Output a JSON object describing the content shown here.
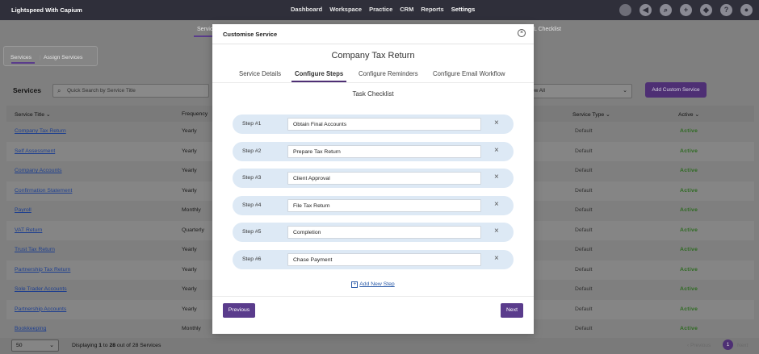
{
  "app": {
    "brand": "Lightspeed With Capium"
  },
  "nav": {
    "items": [
      "Dashboard",
      "Workspace",
      "Practice",
      "CRM",
      "Reports",
      "Settings"
    ],
    "active": "Settings"
  },
  "top_icons": [
    "circle-icon",
    "megaphone-icon",
    "search-icon",
    "plus-icon",
    "tag-icon",
    "help-icon",
    "user-icon"
  ],
  "subtabs": {
    "services": "Servic",
    "checklist": "L Checklist"
  },
  "segment": {
    "services": "Services",
    "assign": "Assign Services"
  },
  "list": {
    "title": "Services",
    "search_placeholder": "Quick Search by Service Title",
    "filter_value": "ow All",
    "add_button": "Add Custom Service",
    "columns": {
      "title": "Service Title",
      "frequency": "Frequency",
      "type": "Service Type",
      "active": "Active"
    },
    "rows": [
      {
        "title": "Company Tax Return",
        "frequency": "Yearly",
        "type": "Default",
        "active": "Active"
      },
      {
        "title": "Self Assessment",
        "frequency": "Yearly",
        "type": "Default",
        "active": "Active"
      },
      {
        "title": "Company Accounts",
        "frequency": "Yearly",
        "type": "Default",
        "active": "Active"
      },
      {
        "title": "Confirmation Statement",
        "frequency": "Yearly",
        "type": "Default",
        "active": "Active"
      },
      {
        "title": "Payroll",
        "frequency": "Monthly",
        "type": "Default",
        "active": "Active"
      },
      {
        "title": "VAT Return",
        "frequency": "Quarterly",
        "type": "Default",
        "active": "Active"
      },
      {
        "title": "Trust Tax Return",
        "frequency": "Yearly",
        "type": "Default",
        "active": "Active"
      },
      {
        "title": "Partnership Tax Return",
        "frequency": "Yearly",
        "type": "Default",
        "active": "Active"
      },
      {
        "title": "Sole Trader Accounts",
        "frequency": "Yearly",
        "type": "Default",
        "active": "Active"
      },
      {
        "title": "Partnership Accounts",
        "frequency": "Yearly",
        "type": "Default",
        "active": "Active"
      },
      {
        "title": "Bookkeeping",
        "frequency": "Monthly",
        "type": "Default",
        "active": "Active"
      }
    ]
  },
  "footer": {
    "page_size": "50",
    "displaying_prefix": "Displaying ",
    "range_start": "1",
    "to": " to ",
    "range_end": "28",
    "total_text": " out of 28 Services",
    "previous": "Previous",
    "page": "1",
    "next": "Next"
  },
  "modal": {
    "title": "Customise Service",
    "service_name": "Company Tax Return",
    "tabs": [
      "Service Details",
      "Configure Steps",
      "Configure Reminders",
      "Configure Email Workflow"
    ],
    "active_tab": "Configure Steps",
    "checklist_title": "Task Checklist",
    "steps": [
      {
        "label": "Step #1",
        "value": "Obtain Final Accounts"
      },
      {
        "label": "Step #2",
        "value": "Prepare Tax Return"
      },
      {
        "label": "Step #3",
        "value": "Client Approval"
      },
      {
        "label": "Step #4",
        "value": "File Tax Return"
      },
      {
        "label": "Step #5",
        "value": "Completion"
      },
      {
        "label": "Step #6",
        "value": "Chase Payment"
      }
    ],
    "add_step": "Add New Step",
    "previous_button": "Previous",
    "next_button": "Next"
  },
  "colors": {
    "accent": "#5a3c8c",
    "link": "#2a5aa8",
    "step_bg": "#dde9f5",
    "active_status": "#2d6a20"
  }
}
